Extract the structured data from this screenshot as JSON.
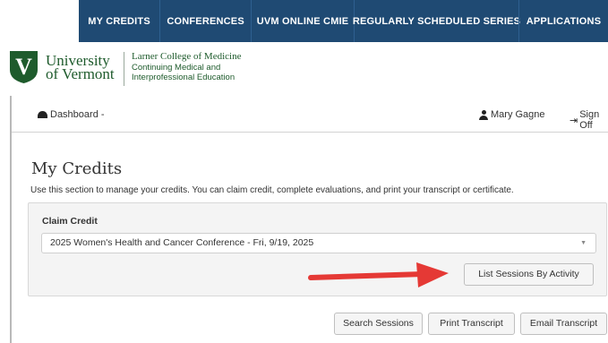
{
  "topnav": {
    "items": [
      {
        "label": "MY CREDITS"
      },
      {
        "label": "CONFERENCES"
      },
      {
        "label": "UVM ONLINE CMIE"
      },
      {
        "label": "REGULARLY SCHEDULED SERIES"
      },
      {
        "label": "APPLICATIONS"
      }
    ]
  },
  "brand": {
    "logo_letter": "V",
    "university_line1": "University",
    "university_line2": "of Vermont",
    "college": "Larner College of Medicine",
    "college_sub1": "Continuing Medical and",
    "college_sub2": "Interprofessional Education",
    "green": "#1e5b2c"
  },
  "userbar": {
    "dashboard": "Dashboard",
    "dashboard_suffix": "-",
    "user_name": "Mary Gagne",
    "sign_off": "Sign Off",
    "dashboard_icon": "dashboard-icon",
    "user_icon": "user-icon",
    "signoff_icon": "sign-out-icon"
  },
  "page": {
    "title": "My Credits",
    "intro": "Use this section to manage your credits. You can claim credit, complete evaluations, and print your transcript or certificate."
  },
  "claim": {
    "label": "Claim Credit",
    "selected": "2025 Women's Health and Cancer Conference - Fri, 9/19, 2025",
    "list_sessions": "List Sessions By Activity"
  },
  "actions": {
    "search_sessions": "Search Sessions",
    "print_transcript": "Print Transcript",
    "email_transcript": "Email Transcript"
  },
  "colors": {
    "nav_bg": "#1f4a73",
    "annotation_arrow": "#e53935"
  }
}
